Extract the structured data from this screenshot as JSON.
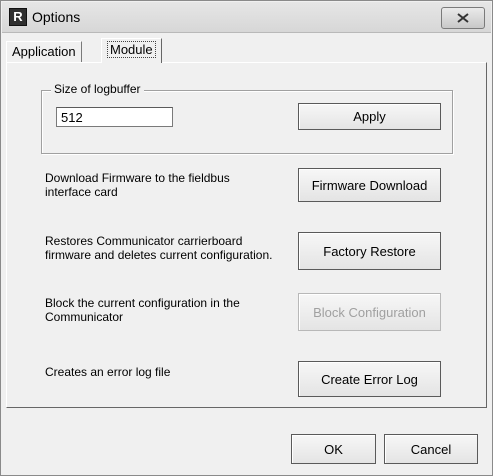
{
  "window": {
    "title": "Options",
    "app_icon_letter": "R",
    "close_glyph": "×"
  },
  "tabs": [
    {
      "label": "Application",
      "selected": false
    },
    {
      "label": "Module",
      "selected": true
    }
  ],
  "logbuffer": {
    "group_title": "Size of logbuffer",
    "value": "512",
    "apply_label": "Apply"
  },
  "actions": [
    {
      "description": "Download Firmware to the fieldbus interface card",
      "button": "Firmware Download",
      "enabled": true
    },
    {
      "description": "Restores Communicator carrierboard firmware and deletes current configuration.",
      "button": "Factory Restore",
      "enabled": true
    },
    {
      "description": "Block the current configuration in the Communicator",
      "button": "Block Configuration",
      "enabled": false
    },
    {
      "description": "Creates an error log file",
      "button": "Create Error Log",
      "enabled": true
    }
  ],
  "footer": {
    "ok_label": "OK",
    "cancel_label": "Cancel"
  },
  "colors": {
    "dialog_bg": "#f0f0f0",
    "disabled_text": "#a0a0a0"
  }
}
